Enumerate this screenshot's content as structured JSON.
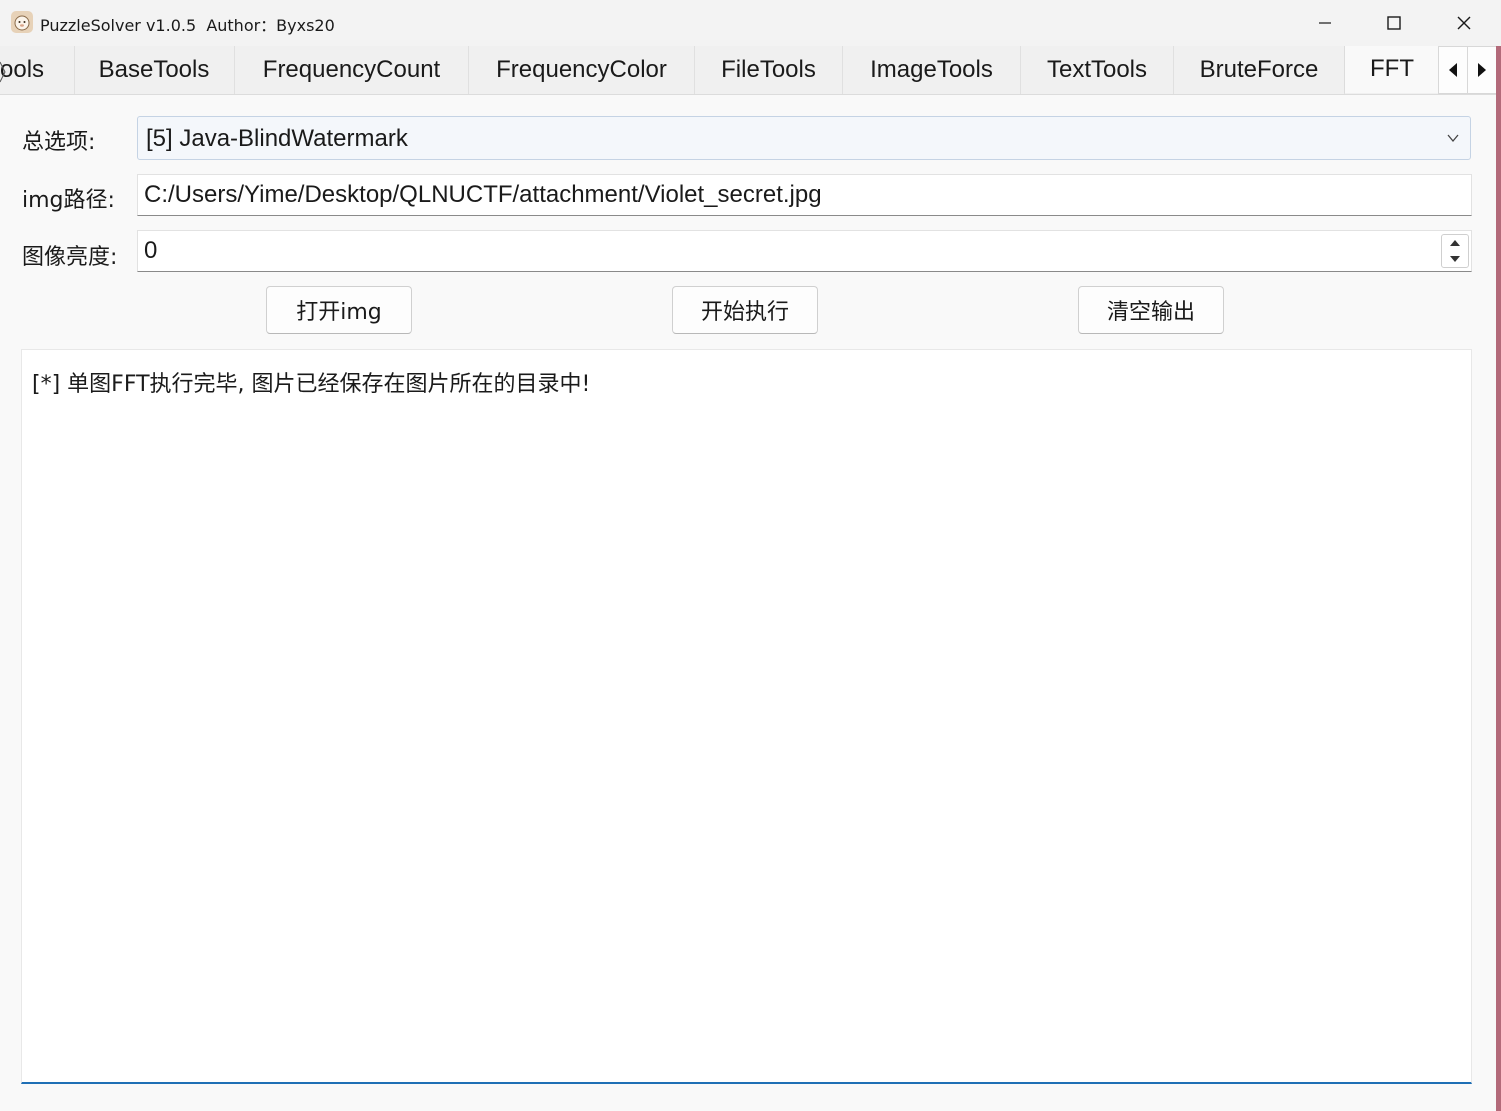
{
  "window": {
    "title": "PuzzleSolver v1.0.5  Author：Byxs20",
    "icon": "sheep-app-icon",
    "controls": [
      "minimize-icon",
      "maximize-icon",
      "close-icon"
    ]
  },
  "tabs": {
    "items": [
      {
        "label": "ools"
      },
      {
        "label": "BaseTools"
      },
      {
        "label": "FrequencyCount"
      },
      {
        "label": "FrequencyColor"
      },
      {
        "label": "FileTools"
      },
      {
        "label": "ImageTools"
      },
      {
        "label": "TextTools"
      },
      {
        "label": "BruteForce"
      },
      {
        "label": "FFT"
      }
    ],
    "active": "FFT",
    "scroll_icons": [
      "arrow-left-icon",
      "arrow-right-icon"
    ]
  },
  "form": {
    "option_label": "总选项:",
    "option_value": "[5] Java-BlindWatermark",
    "img_path_label": "img路径:",
    "img_path_value": "C:/Users/Yime/Desktop/QLNUCTF/attachment/Violet_secret.jpg",
    "brightness_label": "图像亮度:",
    "brightness_value": "0"
  },
  "buttons": {
    "open_img": "打开img",
    "start": "开始执行",
    "clear": "清空输出"
  },
  "output": {
    "text": "[*] 单图FFT执行完毕, 图片已经保存在图片所在的目录中!"
  }
}
